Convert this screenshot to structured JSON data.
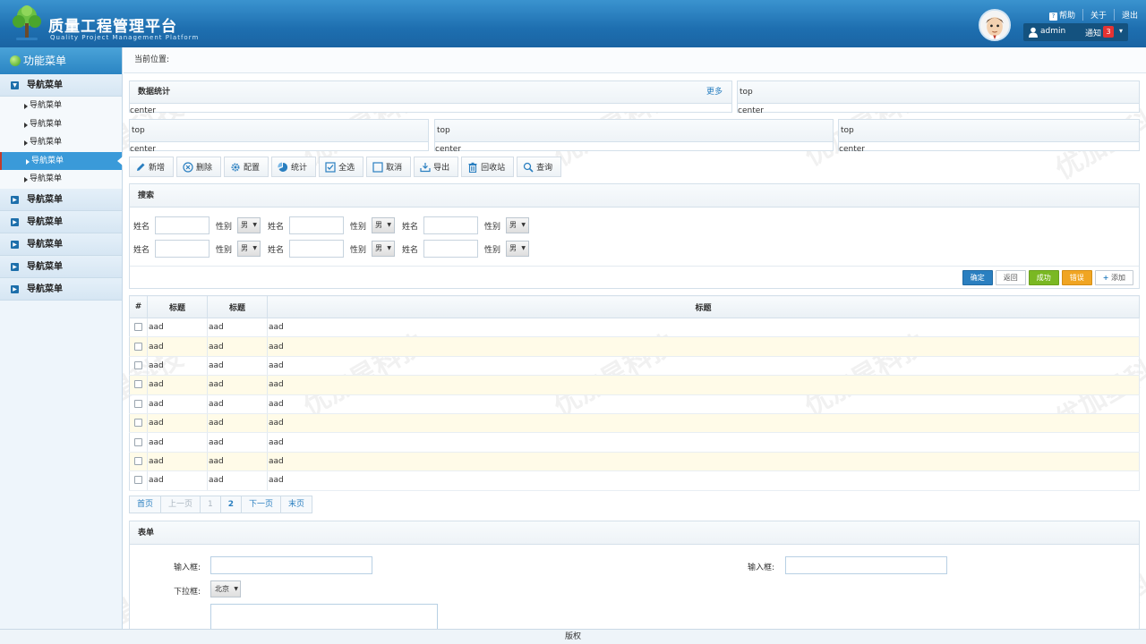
{
  "header": {
    "title": "质量工程管理平台",
    "subtitle": "Quality Project Management Platform",
    "links": [
      "帮助",
      "关于",
      "退出"
    ],
    "user": "admin",
    "notify_label": "通知",
    "notify_count": "3"
  },
  "sidebar": {
    "title": "功能菜单",
    "groups": [
      "导航菜单",
      "导航菜单",
      "导航菜单",
      "导航菜单",
      "导航菜单",
      "导航菜单"
    ],
    "subitems": [
      "导航菜单",
      "导航菜单",
      "导航菜单",
      "导航菜单",
      "导航菜单"
    ]
  },
  "breadcrumb": "当前位置:",
  "panels": {
    "stats_title": "数据统计",
    "stats_more": "更多",
    "top": "top",
    "center": "center"
  },
  "toolbar": [
    "新增",
    "删除",
    "配置",
    "统计",
    "全选",
    "取消",
    "导出",
    "回收站",
    "查询"
  ],
  "search": {
    "title": "搜索",
    "name_label": "姓名",
    "gender_label": "性别",
    "gender_value": "男",
    "buttons": [
      "确定",
      "返回",
      "成功",
      "错误",
      "添加"
    ]
  },
  "table": {
    "headers": [
      "#",
      "标题",
      "标题",
      "标题"
    ],
    "cell": "aad",
    "row_count": 9
  },
  "pager": [
    "首页",
    "上一页",
    "1",
    "2",
    "下一页",
    "末页"
  ],
  "form": {
    "title": "表单",
    "input_label": "输入框:",
    "select_label": "下拉框:",
    "select_value": "北京"
  },
  "footer": "版权",
  "watermark": "优加星科技"
}
